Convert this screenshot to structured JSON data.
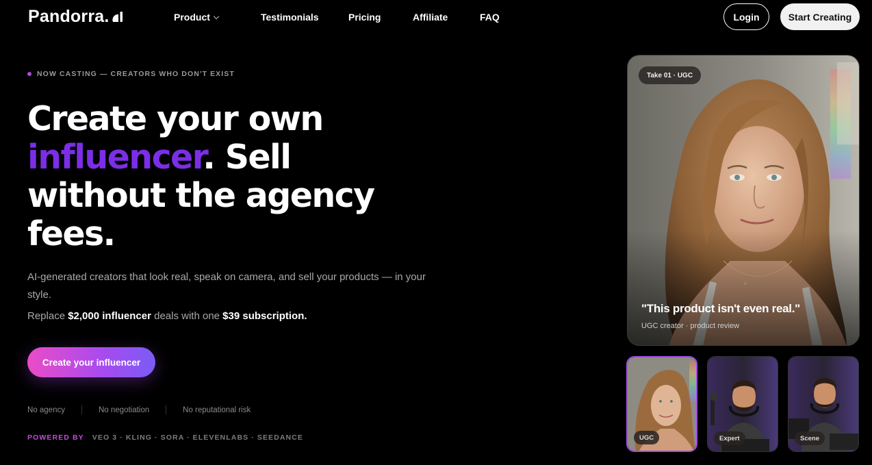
{
  "nav": {
    "logo_text": "Pandorra.",
    "logo_mark": "ai-mark-icon",
    "links": [
      {
        "label": "Product",
        "has_dropdown": true
      },
      {
        "label": "Testimonials"
      },
      {
        "label": "Pricing"
      },
      {
        "label": "Affiliate"
      },
      {
        "label": "FAQ"
      }
    ],
    "login_label": "Login",
    "start_label": "Start Creating"
  },
  "hero": {
    "eyebrow": "NOW CASTING — CREATORS WHO DON'T EXIST",
    "headline_part1": "Create your own ",
    "headline_accent": "influencer",
    "headline_part2": ". Sell without the agency fees.",
    "subtext": "AI-generated creators that look real, speak on camera, and sell your products — in your style.",
    "replace_prefix": "Replace ",
    "replace_amount": "$2,000 influencer",
    "replace_middle": " deals with one ",
    "replace_price": "$39 subscription.",
    "cta_label": "Create your influencer",
    "features": [
      "No agency",
      "No negotiation",
      "No reputational risk"
    ],
    "powered_label": "POWERED BY",
    "powered_value": "VEO 3 · KLING · SORA · ELEVENLABS · SEEDANCE"
  },
  "showcase": {
    "badge": "Take 01 · UGC",
    "quote": "\"This product isn't even real.\"",
    "meta": "UGC creator · product review",
    "thumbs": [
      {
        "label": "UGC",
        "active": true
      },
      {
        "label": "Expert",
        "active": false
      },
      {
        "label": "Scene",
        "active": false
      }
    ]
  },
  "colors": {
    "accent": "#7b2ee6",
    "cta_start": "#ea4cc6",
    "cta_end": "#7a5cf5",
    "powered": "#c24cd9"
  }
}
